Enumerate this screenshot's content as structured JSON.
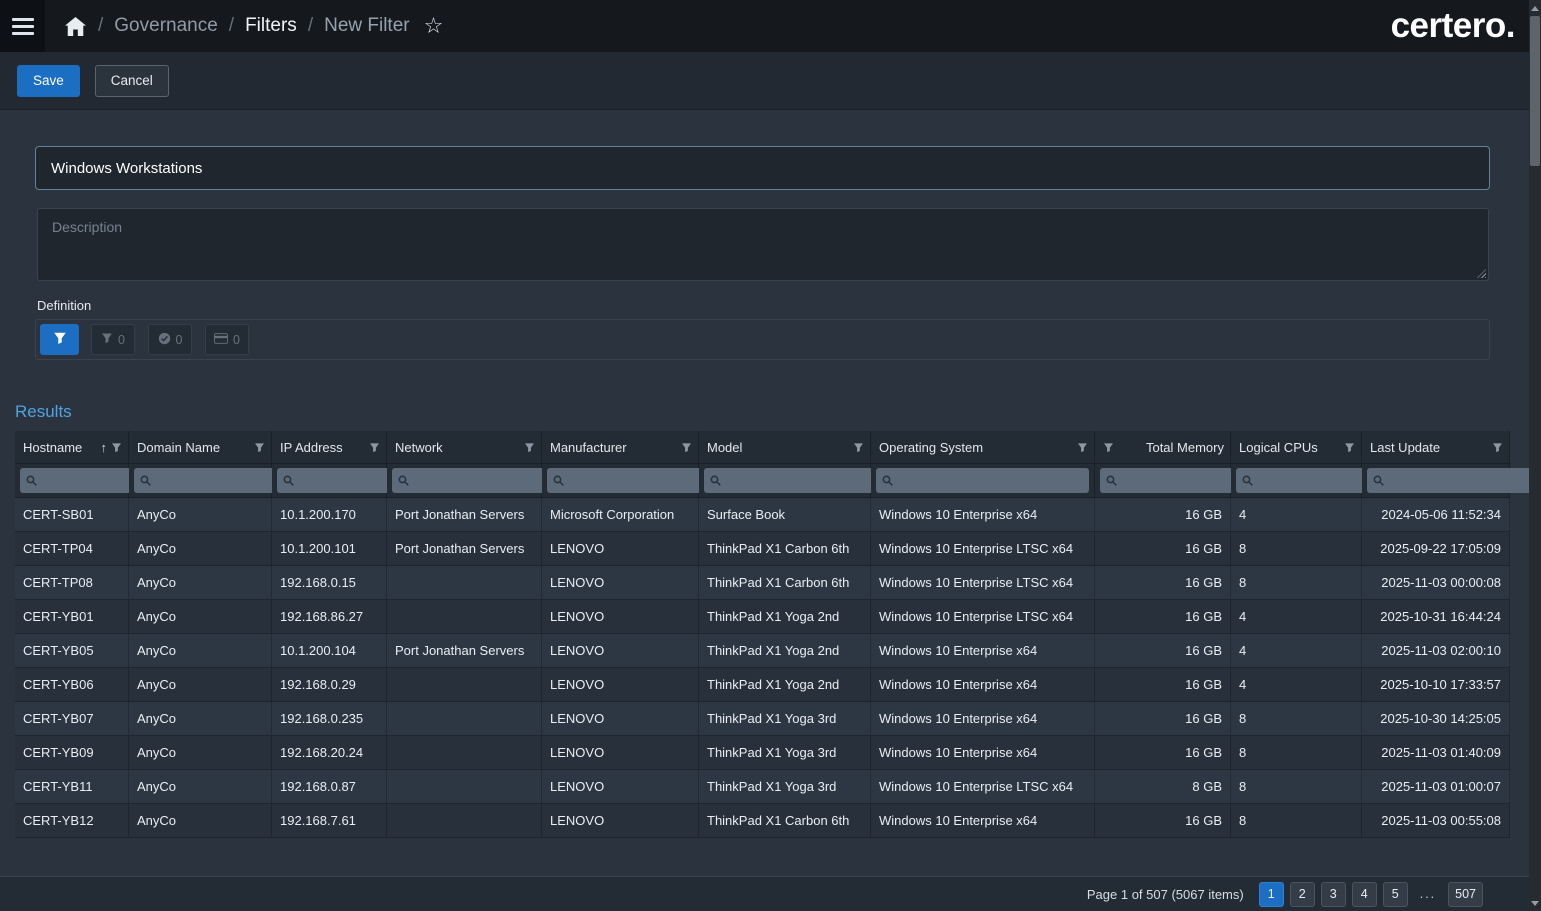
{
  "topbar": {
    "logo": "certero.",
    "breadcrumb": {
      "sep": "/",
      "governance": "Governance",
      "filters": "Filters",
      "new_filter": "New Filter"
    }
  },
  "toolbar": {
    "save": "Save",
    "cancel": "Cancel"
  },
  "form": {
    "name_value": "Windows Workstations",
    "description_placeholder": "Description",
    "definition_label": "Definition",
    "definition_counts": {
      "filter": "0",
      "check": "0",
      "card": "0"
    }
  },
  "results": {
    "heading": "Results",
    "columns": [
      {
        "label": "Hostname",
        "align": "left",
        "sort": "asc"
      },
      {
        "label": "Domain Name",
        "align": "left"
      },
      {
        "label": "IP Address",
        "align": "left"
      },
      {
        "label": "Network",
        "align": "left"
      },
      {
        "label": "Manufacturer",
        "align": "left"
      },
      {
        "label": "Model",
        "align": "left"
      },
      {
        "label": "Operating System",
        "align": "left"
      },
      {
        "label": "Total Memory",
        "align": "right",
        "funnel_left": true
      },
      {
        "label": "Logical CPUs",
        "align": "left"
      },
      {
        "label": "Last Update",
        "align": "right",
        "date_picker": true
      }
    ],
    "rows": [
      [
        "CERT-SB01",
        "AnyCo",
        "10.1.200.170",
        "Port Jonathan Servers",
        "Microsoft Corporation",
        "Surface Book",
        "Windows 10 Enterprise x64",
        "16 GB",
        "4",
        "2024-05-06 11:52:34"
      ],
      [
        "CERT-TP04",
        "AnyCo",
        "10.1.200.101",
        "Port Jonathan Servers",
        "LENOVO",
        "ThinkPad X1 Carbon 6th",
        "Windows 10 Enterprise LTSC x64",
        "16 GB",
        "8",
        "2025-09-22 17:05:09"
      ],
      [
        "CERT-TP08",
        "AnyCo",
        "192.168.0.15",
        "",
        "LENOVO",
        "ThinkPad X1 Carbon 6th",
        "Windows 10 Enterprise LTSC x64",
        "16 GB",
        "8",
        "2025-11-03 00:00:08"
      ],
      [
        "CERT-YB01",
        "AnyCo",
        "192.168.86.27",
        "",
        "LENOVO",
        "ThinkPad X1 Yoga 2nd",
        "Windows 10 Enterprise LTSC x64",
        "16 GB",
        "4",
        "2025-10-31 16:44:24"
      ],
      [
        "CERT-YB05",
        "AnyCo",
        "10.1.200.104",
        "Port Jonathan Servers",
        "LENOVO",
        "ThinkPad X1 Yoga 2nd",
        "Windows 10 Enterprise x64",
        "16 GB",
        "4",
        "2025-11-03 02:00:10"
      ],
      [
        "CERT-YB06",
        "AnyCo",
        "192.168.0.29",
        "",
        "LENOVO",
        "ThinkPad X1 Yoga 2nd",
        "Windows 10 Enterprise x64",
        "16 GB",
        "4",
        "2025-10-10 17:33:57"
      ],
      [
        "CERT-YB07",
        "AnyCo",
        "192.168.0.235",
        "",
        "LENOVO",
        "ThinkPad X1 Yoga 3rd",
        "Windows 10 Enterprise x64",
        "16 GB",
        "8",
        "2025-10-30 14:25:05"
      ],
      [
        "CERT-YB09",
        "AnyCo",
        "192.168.20.24",
        "",
        "LENOVO",
        "ThinkPad X1 Yoga 3rd",
        "Windows 10 Enterprise x64",
        "16 GB",
        "8",
        "2025-11-03 01:40:09"
      ],
      [
        "CERT-YB11",
        "AnyCo",
        "192.168.0.87",
        "",
        "LENOVO",
        "ThinkPad X1 Yoga 3rd",
        "Windows 10 Enterprise LTSC x64",
        "8 GB",
        "8",
        "2025-11-03 01:00:07"
      ],
      [
        "CERT-YB12",
        "AnyCo",
        "192.168.7.61",
        "",
        "LENOVO",
        "ThinkPad X1 Carbon 6th",
        "Windows 10 Enterprise x64",
        "16 GB",
        "8",
        "2025-11-03 00:55:08"
      ]
    ],
    "pagination": {
      "summary": "Page 1 of 507 (5067 items)",
      "pages": [
        {
          "label": "1",
          "active": true
        },
        {
          "label": "2"
        },
        {
          "label": "3"
        },
        {
          "label": "4"
        },
        {
          "label": "5"
        },
        {
          "label": "...",
          "ellipsis": true
        },
        {
          "label": "507"
        }
      ]
    }
  },
  "colors": {
    "accent": "#1b6ec2",
    "heading_link": "#4fa3e2"
  }
}
